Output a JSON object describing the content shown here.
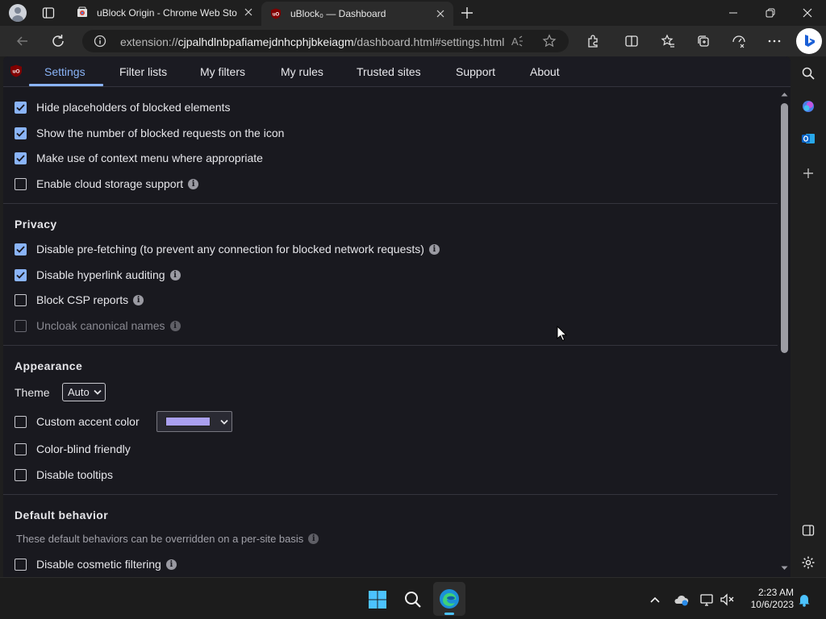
{
  "browser": {
    "tabs": [
      {
        "title": "uBlock Origin - Chrome Web Sto",
        "active": false
      },
      {
        "title": "uBlock₀ — Dashboard",
        "active": true
      }
    ],
    "url_prefix": "extension://",
    "url_host": "cjpalhdlnbpafiamejdnhcphjbkeiagm",
    "url_path": "/dashboard.html#settings.html"
  },
  "nav": {
    "items": [
      "Settings",
      "Filter lists",
      "My filters",
      "My rules",
      "Trusted sites",
      "Support",
      "About"
    ],
    "active": "Settings"
  },
  "general": {
    "options": [
      {
        "label": "Hide placeholders of blocked elements",
        "checked": true,
        "info": false
      },
      {
        "label": "Show the number of blocked requests on the icon",
        "checked": true,
        "info": false
      },
      {
        "label": "Make use of context menu where appropriate",
        "checked": true,
        "info": false
      },
      {
        "label": "Enable cloud storage support",
        "checked": false,
        "info": true
      }
    ]
  },
  "privacy": {
    "title": "Privacy",
    "options": [
      {
        "label": "Disable pre-fetching (to prevent any connection for blocked network requests)",
        "checked": true,
        "info": true
      },
      {
        "label": "Disable hyperlink auditing",
        "checked": true,
        "info": true
      },
      {
        "label": "Block CSP reports",
        "checked": false,
        "info": true
      },
      {
        "label": "Uncloak canonical names",
        "checked": false,
        "info": true,
        "disabled": true
      }
    ]
  },
  "appearance": {
    "title": "Appearance",
    "theme_label": "Theme",
    "theme_value": "Auto",
    "accent_label": "Custom accent color",
    "accent_color": "#aaa0f0",
    "colorblind_label": "Color-blind friendly",
    "tooltips_label": "Disable tooltips"
  },
  "default_behavior": {
    "title": "Default behavior",
    "note": "These default behaviors can be overridden on a per-site basis",
    "cosmetic_label": "Disable cosmetic filtering"
  },
  "taskbar": {
    "time": "2:23 AM",
    "date": "10/6/2023"
  },
  "colors": {
    "accent": "#8ab4f8",
    "panel_bg": "#19191f",
    "ublock_red": "#800000"
  }
}
